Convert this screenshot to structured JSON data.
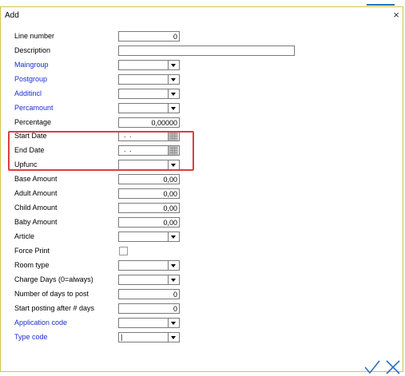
{
  "dialog": {
    "title": "Add",
    "close_glyph": "×"
  },
  "fields": [
    {
      "label": "Line number",
      "type": "text",
      "value": "0",
      "blue": false
    },
    {
      "label": "Description",
      "type": "text-wide",
      "value": "",
      "blue": false
    },
    {
      "label": "Maingroup",
      "type": "combo",
      "value": "",
      "blue": true
    },
    {
      "label": "Postgroup",
      "type": "combo",
      "value": "",
      "blue": true
    },
    {
      "label": "Additincl",
      "type": "combo",
      "value": "",
      "blue": true
    },
    {
      "label": "Percamount",
      "type": "combo",
      "value": "",
      "blue": true
    },
    {
      "label": "Percentage",
      "type": "text",
      "value": "0,00000",
      "blue": false
    },
    {
      "label": "Start Date",
      "type": "date",
      "value": ". .",
      "blue": false
    },
    {
      "label": "End Date",
      "type": "date",
      "value": ". .",
      "blue": false
    },
    {
      "label": "Upfunc",
      "type": "combo",
      "value": "",
      "blue": false
    },
    {
      "label": "Base Amount",
      "type": "text",
      "value": "0,00",
      "blue": false
    },
    {
      "label": "Adult Amount",
      "type": "text",
      "value": "0,00",
      "blue": false
    },
    {
      "label": "Child Amount",
      "type": "text",
      "value": "0,00",
      "blue": false
    },
    {
      "label": "Baby Amount",
      "type": "text",
      "value": "0,00",
      "blue": false
    },
    {
      "label": "Article",
      "type": "combo",
      "value": "",
      "blue": false
    },
    {
      "label": "Force Print",
      "type": "checkbox",
      "value": "",
      "blue": false
    },
    {
      "label": "Room type",
      "type": "combo",
      "value": "",
      "blue": false
    },
    {
      "label": "Charge Days (0=always)",
      "type": "combo",
      "value": "",
      "blue": false
    },
    {
      "label": "Number of days to post",
      "type": "text",
      "value": "0",
      "blue": false
    },
    {
      "label": "Start posting after # days",
      "type": "text",
      "value": "0",
      "blue": false
    },
    {
      "label": "Application code",
      "type": "combo",
      "value": "",
      "blue": true
    },
    {
      "label": "Type code",
      "type": "combo",
      "value": "|",
      "blue": true
    }
  ],
  "footer": {
    "ok_icon": "checkmark-icon",
    "cancel_icon": "x-icon"
  },
  "colors": {
    "link_blue": "#1a2ecf",
    "highlight_red": "#e03c3c",
    "accent_blue": "#1f6fc5"
  }
}
